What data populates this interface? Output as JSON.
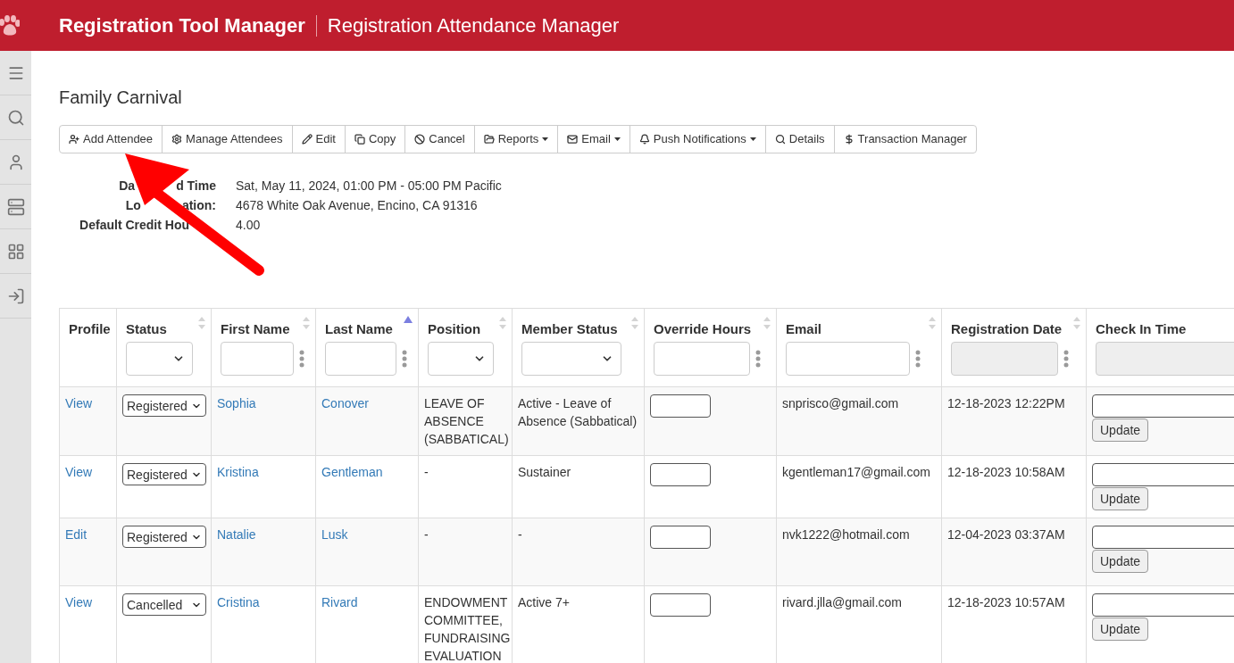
{
  "header": {
    "app_title": "Registration Tool Manager",
    "page_title": "Registration Attendance Manager"
  },
  "event": {
    "title": "Family Carnival"
  },
  "toolbar": [
    {
      "label": "Add Attendee",
      "dropdown": false
    },
    {
      "label": "Manage Attendees",
      "dropdown": false
    },
    {
      "label": "Edit",
      "dropdown": false
    },
    {
      "label": "Copy",
      "dropdown": false
    },
    {
      "label": "Cancel",
      "dropdown": false
    },
    {
      "label": "Reports",
      "dropdown": true
    },
    {
      "label": "Email",
      "dropdown": true
    },
    {
      "label": "Push Notifications",
      "dropdown": true
    },
    {
      "label": "Details",
      "dropdown": false
    },
    {
      "label": "Transaction Manager",
      "dropdown": false
    }
  ],
  "details": [
    {
      "label_parts": [
        "Da",
        "d Time"
      ],
      "cut_end": false,
      "value": "Sat, May 11, 2024, 01:00 PM - 05:00 PM Pacific"
    },
    {
      "label_parts": [
        "Lo",
        "ation:"
      ],
      "cut_end": false,
      "value": "4678 White Oak Avenue, Encino, CA 91316"
    },
    {
      "label_parts": [
        "Default Credit Hou"
      ],
      "cut_end": true,
      "value": "4.00"
    }
  ],
  "table": {
    "columns": [
      {
        "label": "Profile",
        "sortable": false
      },
      {
        "label": "Status",
        "sortable": true,
        "sorted_ascending": false,
        "filter": {
          "kind": "select",
          "disabled": false
        }
      },
      {
        "label": "First Name",
        "sortable": true,
        "sorted_ascending": false,
        "filter": {
          "kind": "text",
          "disabled": false,
          "menu": true
        }
      },
      {
        "label": "Last Name",
        "sortable": true,
        "sorted_ascending": true,
        "filter": {
          "kind": "text",
          "disabled": false,
          "menu": true
        }
      },
      {
        "label": "Position",
        "sortable": true,
        "sorted_ascending": false,
        "filter": {
          "kind": "select",
          "disabled": false
        }
      },
      {
        "label": "Member Status",
        "sortable": true,
        "sorted_ascending": false,
        "filter": {
          "kind": "select",
          "disabled": false
        }
      },
      {
        "label": "Override Hours",
        "sortable": true,
        "sorted_ascending": false,
        "filter": {
          "kind": "text",
          "disabled": false,
          "menu": true
        }
      },
      {
        "label": "Email",
        "sortable": true,
        "sorted_ascending": false,
        "filter": {
          "kind": "text",
          "disabled": false,
          "menu": true
        }
      },
      {
        "label": "Registration Date",
        "sortable": true,
        "sorted_ascending": false,
        "filter": {
          "kind": "text",
          "disabled": true,
          "menu": true
        }
      },
      {
        "label": "Check In Time",
        "sortable": false,
        "filter": {
          "kind": "text",
          "disabled": true,
          "menu": false
        }
      }
    ],
    "rows": [
      {
        "profile": "View",
        "status": "Registered",
        "first_name": "Sophia",
        "last_name": "Conover",
        "position": "LEAVE OF ABSENCE (SABBATICAL)",
        "member_status": "Active - Leave of Absence (Sabbatical)",
        "email": "snprisco@gmail.com",
        "registration_date": "12-18-2023 12:22PM",
        "update": "Update"
      },
      {
        "profile": "View",
        "status": "Registered",
        "first_name": "Kristina",
        "last_name": "Gentleman",
        "position": "-",
        "member_status": "Sustainer",
        "email": "kgentleman17@gmail.com",
        "registration_date": "12-18-2023 10:58AM",
        "update": "Update"
      },
      {
        "profile": "Edit",
        "status": "Registered",
        "first_name": "Natalie",
        "last_name": "Lusk",
        "position": "-",
        "member_status": "-",
        "email": "nvk1222@hotmail.com",
        "registration_date": "12-04-2023 03:37AM",
        "update": "Update"
      },
      {
        "profile": "View",
        "status": "Cancelled",
        "first_name": "Cristina",
        "last_name": "Rivard",
        "position": "ENDOWMENT COMMITTEE, FUNDRAISING EVALUATION",
        "member_status": "Active 7+",
        "email": "rivard.jlla@gmail.com",
        "registration_date": "12-18-2023 10:57AM",
        "update": "Update"
      }
    ]
  }
}
